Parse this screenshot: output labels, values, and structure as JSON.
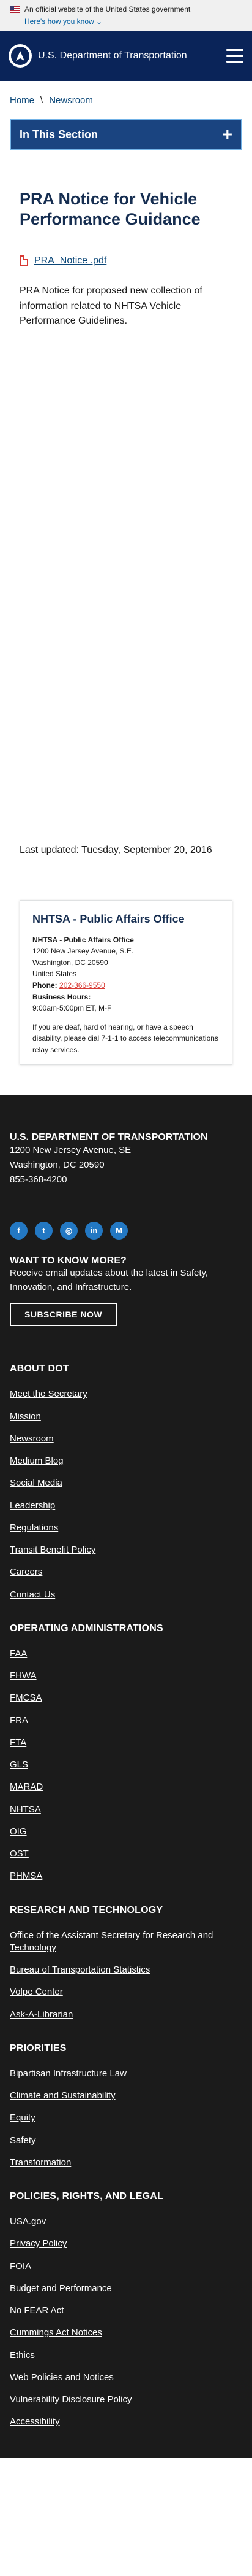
{
  "gov_banner": {
    "text": "An official website of the United States government",
    "how_link": "Here's how you know"
  },
  "header": {
    "site_title": "U.S. Department of Transportation"
  },
  "breadcrumb": {
    "items": [
      "Home",
      "Newsroom"
    ]
  },
  "section_nav": {
    "label": "In This Section"
  },
  "main": {
    "title": "PRA Notice for Vehicle Performance Guidance",
    "attachment_label": "PRA_Notice .pdf",
    "description": "PRA Notice for proposed new collection of information related to NHTSA Vehicle Performance Guidelines.",
    "last_updated": "Last updated: Tuesday, September 20, 2016"
  },
  "contact": {
    "title": "NHTSA - Public Affairs Office",
    "org": "NHTSA - Public Affairs Office",
    "address_lines": [
      "1200 New Jersey Avenue, S.E.",
      "Washington, DC 20590",
      "United States"
    ],
    "phone_label": "Phone:",
    "phone": "202-366-9550",
    "hours_label": "Business Hours:",
    "hours": "9:00am-5:00pm ET, M-F",
    "note": "If you are deaf, hard of hearing, or have a speech disability, please dial 7-1-1 to access telecommunications relay services."
  },
  "footer": {
    "org_name": "U.S. DEPARTMENT OF TRANSPORTATION",
    "address_lines": [
      "1200 New Jersey Avenue, SE",
      "Washington, DC 20590",
      "855-368-4200"
    ],
    "social": [
      {
        "icon": "facebook-icon",
        "glyph": "f"
      },
      {
        "icon": "twitter-icon",
        "glyph": "t"
      },
      {
        "icon": "instagram-icon",
        "glyph": "◎"
      },
      {
        "icon": "linkedin-icon",
        "glyph": "in"
      },
      {
        "icon": "medium-icon",
        "glyph": "M"
      }
    ],
    "want_more_heading": "WANT TO KNOW MORE?",
    "want_more_text": "Receive email updates about the latest in Safety, Innovation, and Infrastructure.",
    "subscribe_label": "SUBSCRIBE NOW",
    "sections": [
      {
        "heading": "ABOUT DOT",
        "links": [
          "Meet the Secretary",
          "Mission",
          "Newsroom",
          "Medium Blog",
          "Social Media",
          "Leadership",
          "Regulations",
          "Transit Benefit Policy",
          "Careers",
          "Contact Us"
        ]
      },
      {
        "heading": "OPERATING ADMINISTRATIONS",
        "links": [
          "FAA",
          "FHWA",
          "FMCSA",
          "FRA",
          "FTA",
          "GLS",
          "MARAD",
          "NHTSA",
          "OIG",
          "OST",
          "PHMSA"
        ]
      },
      {
        "heading": "RESEARCH AND TECHNOLOGY",
        "links": [
          "Office of the Assistant Secretary for Research and Technology",
          "Bureau of Transportation Statistics",
          "Volpe Center",
          "Ask-A-Librarian"
        ]
      },
      {
        "heading": "PRIORITIES",
        "links": [
          "Bipartisan Infrastructure Law",
          "Climate and Sustainability",
          "Equity",
          "Safety",
          "Transformation"
        ]
      },
      {
        "heading": "POLICIES, RIGHTS, AND LEGAL",
        "links": [
          "USA.gov",
          "Privacy Policy",
          "FOIA",
          "Budget and Performance",
          "No FEAR Act",
          "Cummings Act Notices",
          "Ethics",
          "Web Policies and Notices",
          "Vulnerability Disclosure Policy",
          "Accessibility"
        ]
      }
    ]
  }
}
